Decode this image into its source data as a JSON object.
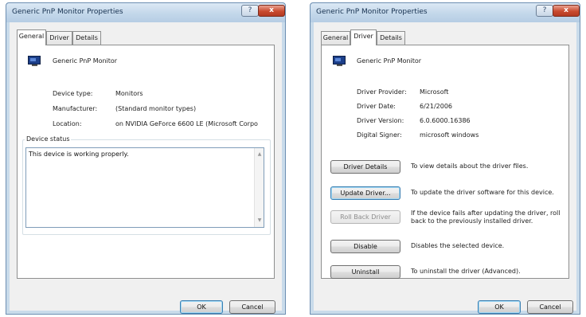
{
  "dialog1": {
    "title": "Generic PnP Monitor Properties",
    "help_label": "?",
    "close_label": "x",
    "tabs": [
      {
        "label": "General"
      },
      {
        "label": "Driver"
      },
      {
        "label": "Details"
      }
    ],
    "active_tab": "General",
    "device_name": "Generic PnP Monitor",
    "properties": [
      {
        "label": "Device type:",
        "value": "Monitors"
      },
      {
        "label": "Manufacturer:",
        "value": "(Standard monitor types)"
      },
      {
        "label": "Location:",
        "value": "on NVIDIA GeForce 6600 LE (Microsoft Corpo"
      }
    ],
    "device_status": {
      "title": "Device status",
      "text": "This device is working properly."
    },
    "ok_label": "OK",
    "cancel_label": "Cancel"
  },
  "dialog2": {
    "title": "Generic PnP Monitor Properties",
    "help_label": "?",
    "close_label": "x",
    "tabs": [
      {
        "label": "General"
      },
      {
        "label": "Driver"
      },
      {
        "label": "Details"
      }
    ],
    "active_tab": "Driver",
    "device_name": "Generic PnP Monitor",
    "properties": [
      {
        "label": "Driver Provider:",
        "value": "Microsoft"
      },
      {
        "label": "Driver Date:",
        "value": "6/21/2006"
      },
      {
        "label": "Driver Version:",
        "value": "6.0.6000.16386"
      },
      {
        "label": "Digital Signer:",
        "value": "microsoft windows"
      }
    ],
    "actions": [
      {
        "button": "Driver Details",
        "description": "To view details about the driver files.",
        "enabled": true
      },
      {
        "button": "Update Driver...",
        "description": "To update the driver software for this device.",
        "enabled": true
      },
      {
        "button": "Roll Back Driver",
        "description": "If the device fails after updating the driver, roll back to the previously installed driver.",
        "enabled": false
      },
      {
        "button": "Disable",
        "description": "Disables the selected device.",
        "enabled": true
      },
      {
        "button": "Uninstall",
        "description": "To uninstall the driver (Advanced).",
        "enabled": true
      }
    ],
    "ok_label": "OK",
    "cancel_label": "Cancel"
  }
}
